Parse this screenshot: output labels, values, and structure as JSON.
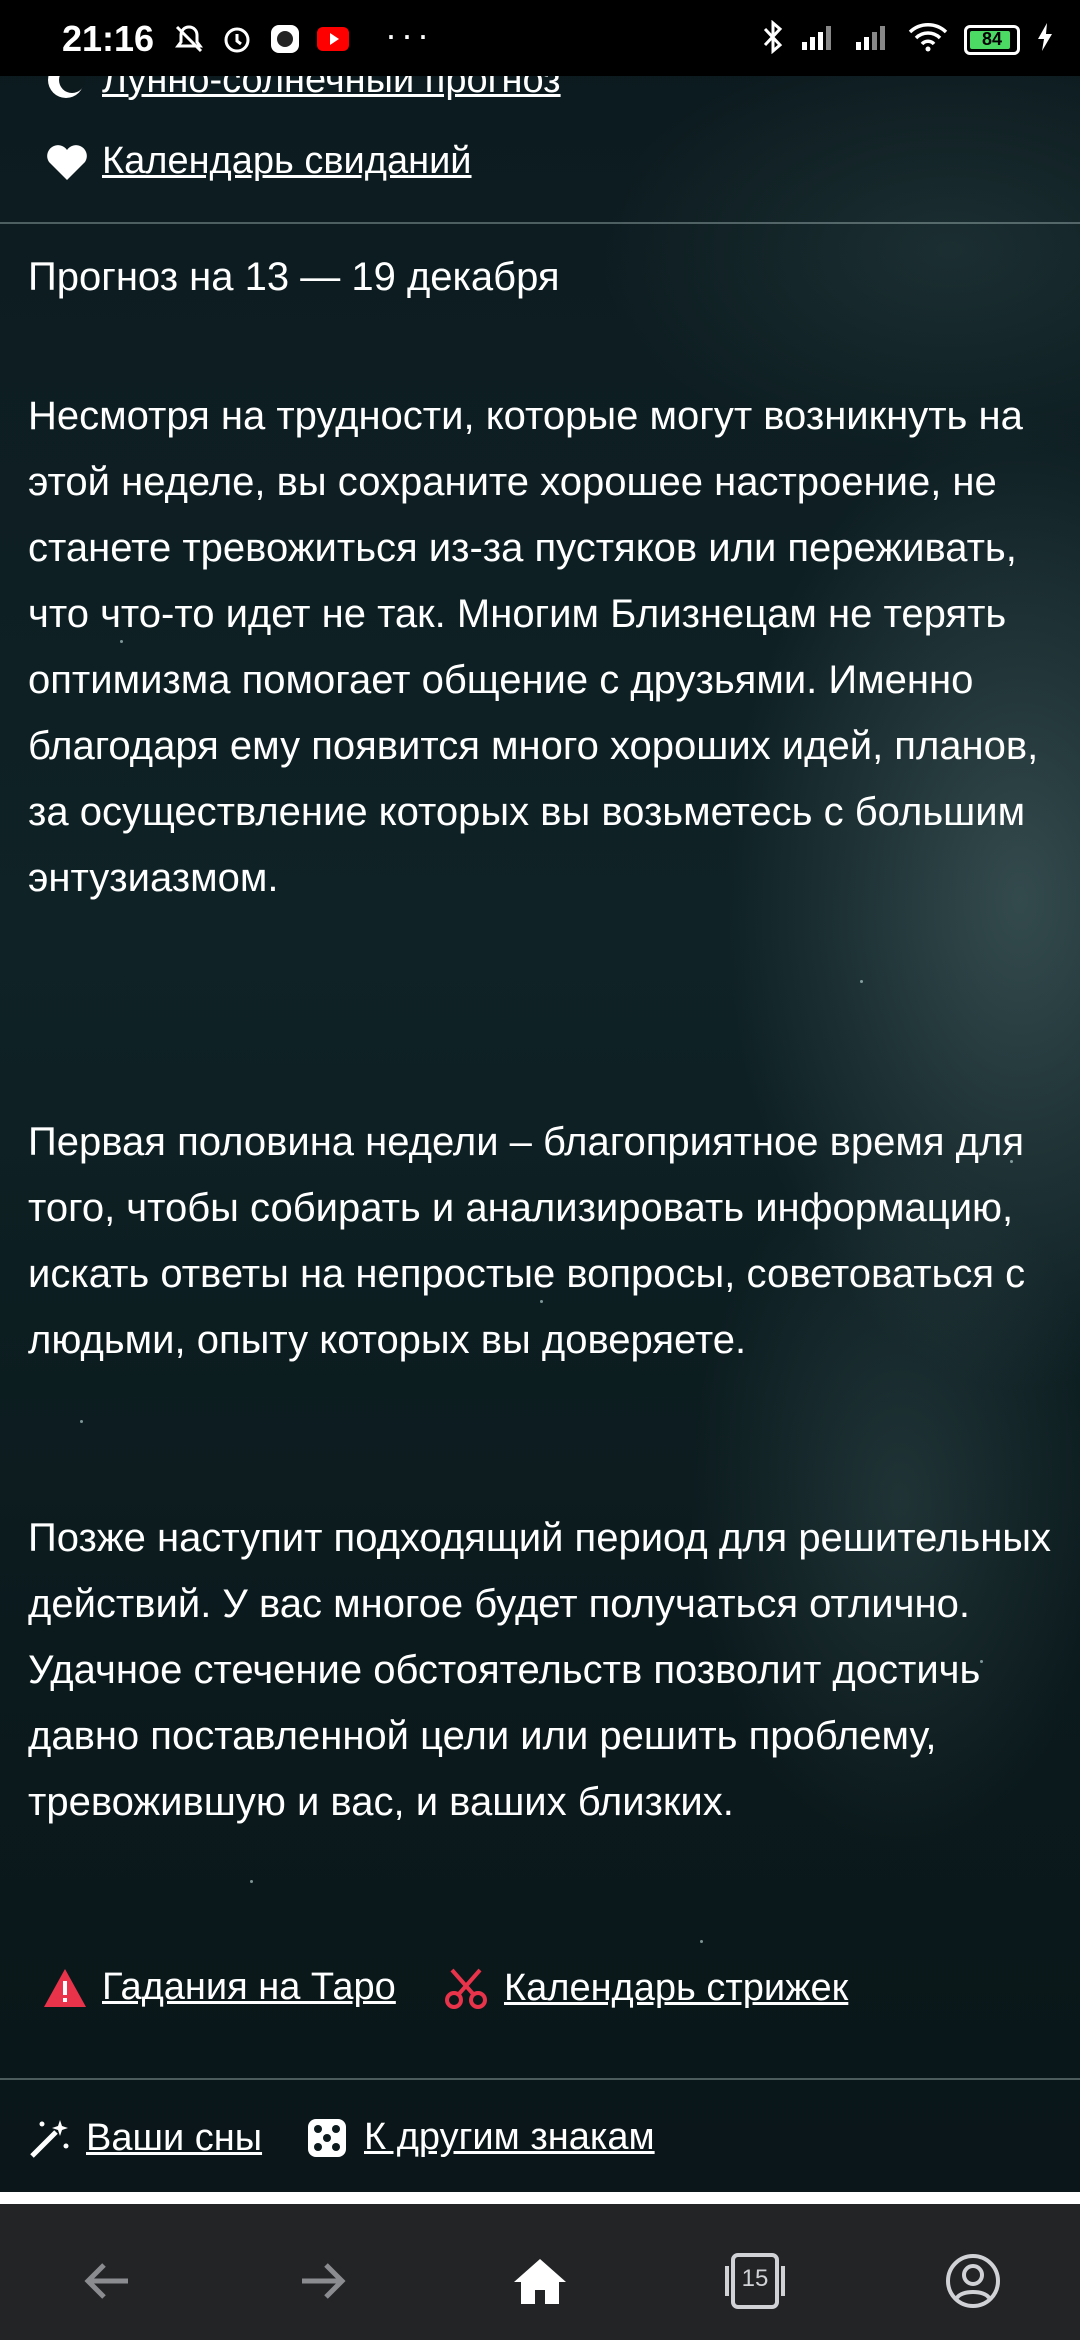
{
  "status_bar": {
    "time": "21:16",
    "battery_percent": "84",
    "icons_left": [
      "mute-notifications-icon",
      "alarm-icon",
      "app-icon",
      "youtube-icon"
    ],
    "icons_right": [
      "bluetooth-icon",
      "signal-icon",
      "signal-icon",
      "wifi-icon",
      "battery-icon",
      "charging-icon"
    ],
    "more": "···"
  },
  "top_links": [
    {
      "icon": "sun-moon-icon",
      "label": "Лунно-солнечный прогноз"
    },
    {
      "icon": "heart-icon",
      "label": "Календарь свиданий"
    }
  ],
  "forecast": {
    "title": "Прогноз на 13 — 19 декабря",
    "paragraphs": [
      "Несмотря на трудности, которые могут возникнуть на этой неделе, вы сохраните хорошее настроение, не станете тревожиться из-за пустяков или переживать, что что-то идет не так. Многим Близнецам не терять оптимизма помогает общение с друзьями. Именно благодаря ему появится много хороших идей, планов, за осуществление которых вы возьметесь с большим энтузиазмом.",
      "Первая половина недели – благоприятное время для того, чтобы собирать и анализировать информацию, искать ответы на непростые вопросы, советоваться с людьми, опыту которых вы доверяете.",
      "Позже наступит подходящий период для решительных действий. У вас многое будет получаться отлично. Удачное стечение обстоятельств позволит достичь давно поставленной цели или решить проблему, тревожившую и вас, и ваших близких."
    ]
  },
  "bottom_links": [
    {
      "icon": "warning-triangle-icon",
      "label": "Гадания на Таро"
    },
    {
      "icon": "scissors-icon",
      "label": "Календарь стрижек"
    }
  ],
  "footer_links": [
    {
      "icon": "magic-wand-icon",
      "label": "Ваши сны"
    },
    {
      "icon": "dice-icon",
      "label": "К другим знакам"
    }
  ],
  "browser_nav": {
    "tabs_count": "15",
    "buttons": [
      "back-arrow-icon",
      "forward-arrow-icon",
      "home-icon",
      "tabs-icon",
      "account-icon"
    ]
  },
  "colors": {
    "accent_red": "#e8334a",
    "nav_bg": "#232426",
    "battery_green": "#4cd964"
  }
}
